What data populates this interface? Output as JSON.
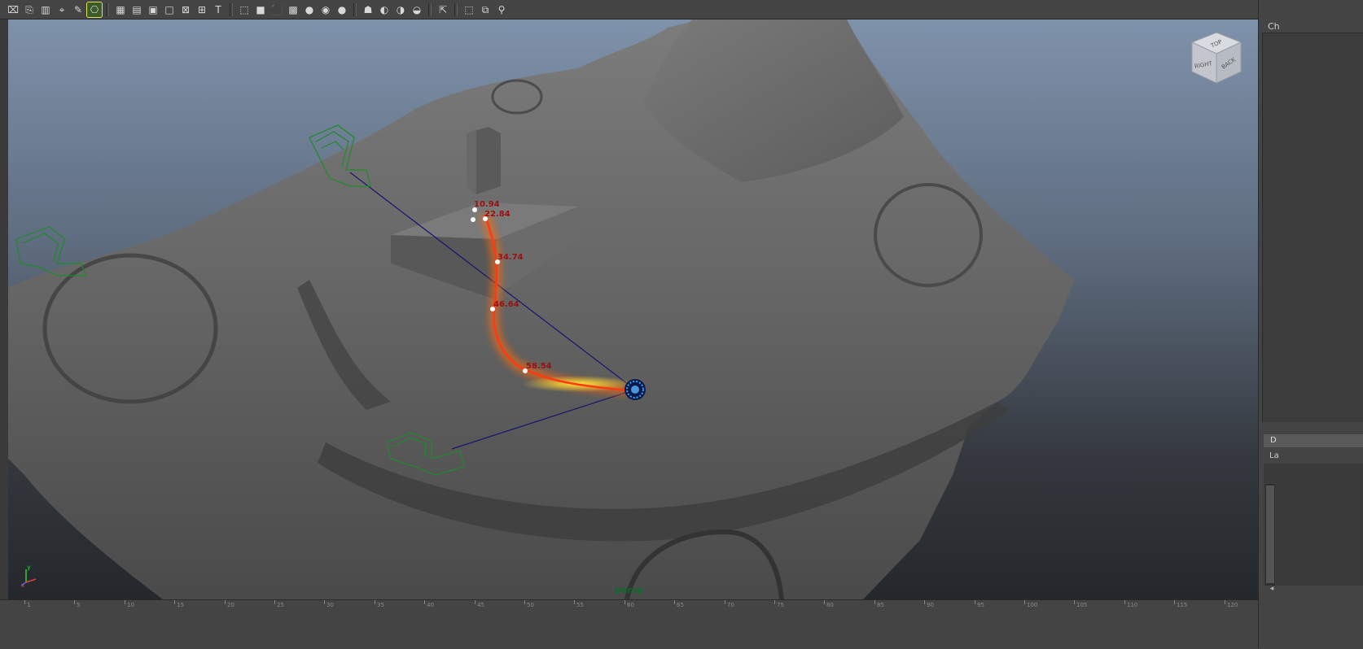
{
  "toolbar": {
    "groups": [
      {
        "name": "camera-tools-group",
        "items": [
          {
            "name": "camera-attributes-icon",
            "glyph": "⌧"
          },
          {
            "name": "bookmark-icon",
            "glyph": "⎘"
          },
          {
            "name": "image-plane-icon",
            "glyph": "▥"
          },
          {
            "name": "2d-pan-zoom-icon",
            "glyph": "⌖"
          },
          {
            "name": "grease-pencil-icon",
            "glyph": "✎"
          },
          {
            "name": "film-gate-icon",
            "glyph": "⎔",
            "active": true
          }
        ]
      },
      {
        "name": "display-toggles-group",
        "items": [
          {
            "name": "grid-icon",
            "glyph": "▦"
          },
          {
            "name": "field-chart-icon",
            "glyph": "▤"
          },
          {
            "name": "safe-action-icon",
            "glyph": "▣"
          },
          {
            "name": "safe-title-icon",
            "glyph": "□"
          },
          {
            "name": "resolution-gate-icon",
            "glyph": "⊠"
          },
          {
            "name": "gate-mask-icon",
            "glyph": "⊞"
          },
          {
            "name": "heads-up-display-icon",
            "glyph": "T"
          }
        ]
      },
      {
        "name": "shading-group",
        "items": [
          {
            "name": "wireframe-icon",
            "glyph": "⬚"
          },
          {
            "name": "smooth-shade-icon",
            "glyph": "■"
          },
          {
            "name": "wireframe-on-shaded-icon",
            "glyph": "⬛"
          },
          {
            "name": "textured-icon",
            "glyph": "▩"
          },
          {
            "name": "use-all-lights-icon",
            "glyph": "●"
          },
          {
            "name": "shadows-icon",
            "glyph": "◉"
          },
          {
            "name": "default-material-icon",
            "glyph": "●"
          }
        ]
      },
      {
        "name": "render-quality-group",
        "items": [
          {
            "name": "isolate-select-icon",
            "glyph": "☗"
          },
          {
            "name": "xray-icon",
            "glyph": "◐"
          },
          {
            "name": "xray-joints-icon",
            "glyph": "◑"
          },
          {
            "name": "backface-icon",
            "glyph": "◒"
          }
        ]
      },
      {
        "name": "selection-group",
        "items": [
          {
            "name": "select-camera-icon",
            "glyph": "⇱"
          }
        ]
      },
      {
        "name": "panel-layout-group",
        "items": [
          {
            "name": "single-pane-icon",
            "glyph": "⬚"
          },
          {
            "name": "two-pane-icon",
            "glyph": "⧉"
          },
          {
            "name": "node-editor-icon",
            "glyph": "⚲"
          }
        ]
      }
    ]
  },
  "viewport": {
    "camera_label": "persp",
    "viewcube_faces": [
      "TOP",
      "RIGHT",
      "BACK"
    ],
    "axis_labels": [
      "y",
      "x",
      "z"
    ],
    "motion_path_frames": [
      "10.94",
      "22.84",
      "34.74",
      "46.64",
      "58.54"
    ]
  },
  "right_panel": {
    "channel_box_label": "Ch",
    "display_layer_tab": "D",
    "layer_text": "La"
  },
  "timeline": {
    "tick_numbers": [
      "1",
      "5",
      "10",
      "15",
      "20",
      "25",
      "30",
      "35",
      "40",
      "45",
      "50",
      "55",
      "60",
      "65",
      "70",
      "75",
      "80",
      "85",
      "90",
      "95",
      "100",
      "105",
      "110",
      "115",
      "120"
    ]
  },
  "colors": {
    "viewport_top": "#7f92ab",
    "viewport_bottom": "#24272b",
    "terrain": "#6e6e6e",
    "motion_path": "#ff3a12",
    "frame_label": "#9b1010",
    "camera_wire": "#1f8a2a",
    "aim_line": "#1a1a6a",
    "persp_label": "#0f6a2a"
  }
}
